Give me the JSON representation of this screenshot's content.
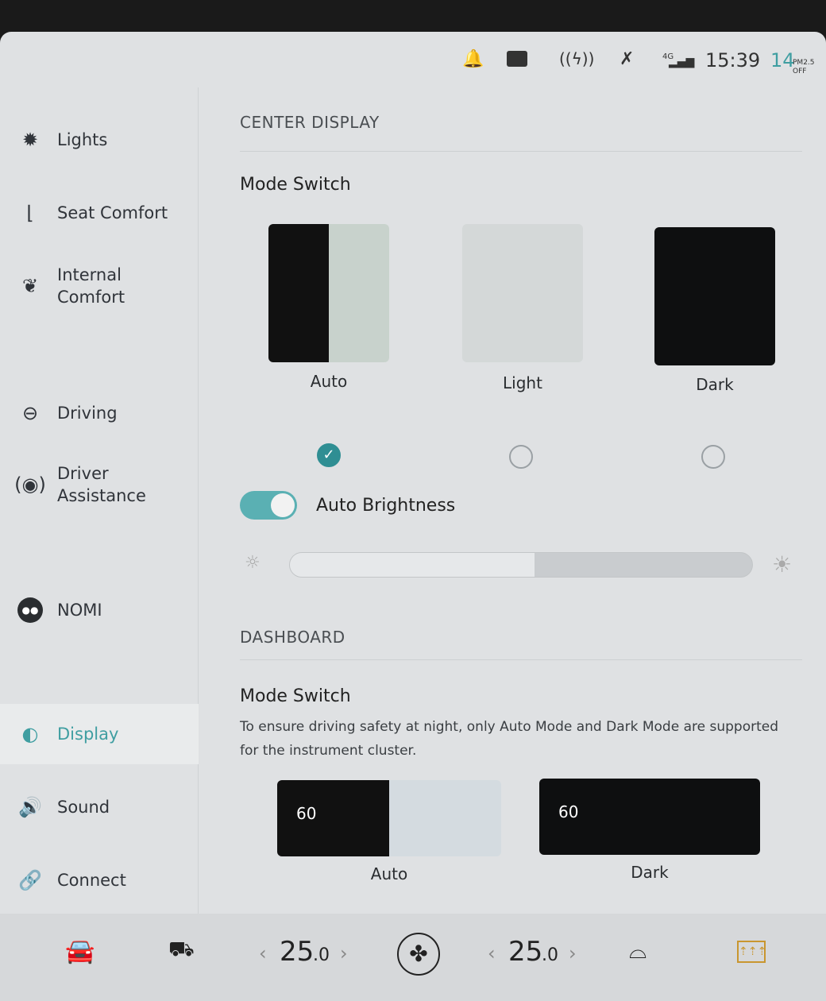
{
  "status": {
    "time": "15:39",
    "pm25_value": "14",
    "pm25_label": "PM2.5",
    "pm25_state": "OFF",
    "network": "4G",
    "icons": [
      "notification-bell-icon",
      "dashcam-icon",
      "wireless-charging-icon",
      "bluetooth-off-icon",
      "signal-icon"
    ]
  },
  "sidebar": {
    "items": [
      {
        "label": "Lights",
        "icon": "light-icon"
      },
      {
        "label": "Seat Comfort",
        "icon": "seat-icon"
      },
      {
        "label": "Internal Comfort",
        "icon": "leaf-icon"
      },
      {
        "label": "Driving",
        "icon": "steering-wheel-icon"
      },
      {
        "label": "Driver Assistance",
        "icon": "driver-assist-icon"
      },
      {
        "label": "NOMI",
        "icon": "nomi-icon"
      },
      {
        "label": "Display",
        "icon": "display-icon",
        "active": true
      },
      {
        "label": "Sound",
        "icon": "speaker-icon"
      },
      {
        "label": "Connect",
        "icon": "link-icon"
      }
    ]
  },
  "center": {
    "section": "CENTER DISPLAY",
    "mode_title": "Mode Switch",
    "modes": [
      "Auto",
      "Light",
      "Dark"
    ],
    "selected": "Auto",
    "auto_brightness_label": "Auto Brightness",
    "auto_brightness_on": true,
    "brightness_percent": 53
  },
  "dashboard": {
    "section": "DASHBOARD",
    "mode_title": "Mode Switch",
    "description": "To ensure driving safety at night, only Auto Mode and Dark Mode are supported for the instrument cluster.",
    "modes": [
      "Auto",
      "Dark"
    ],
    "speed": "60",
    "selected": "Dark"
  },
  "climate": {
    "left_temp": "25",
    "left_dec": ".0",
    "right_temp": "25",
    "right_dec": ".0",
    "accent": "#c9962f"
  },
  "colors": {
    "accent": "#3f9ea1"
  }
}
